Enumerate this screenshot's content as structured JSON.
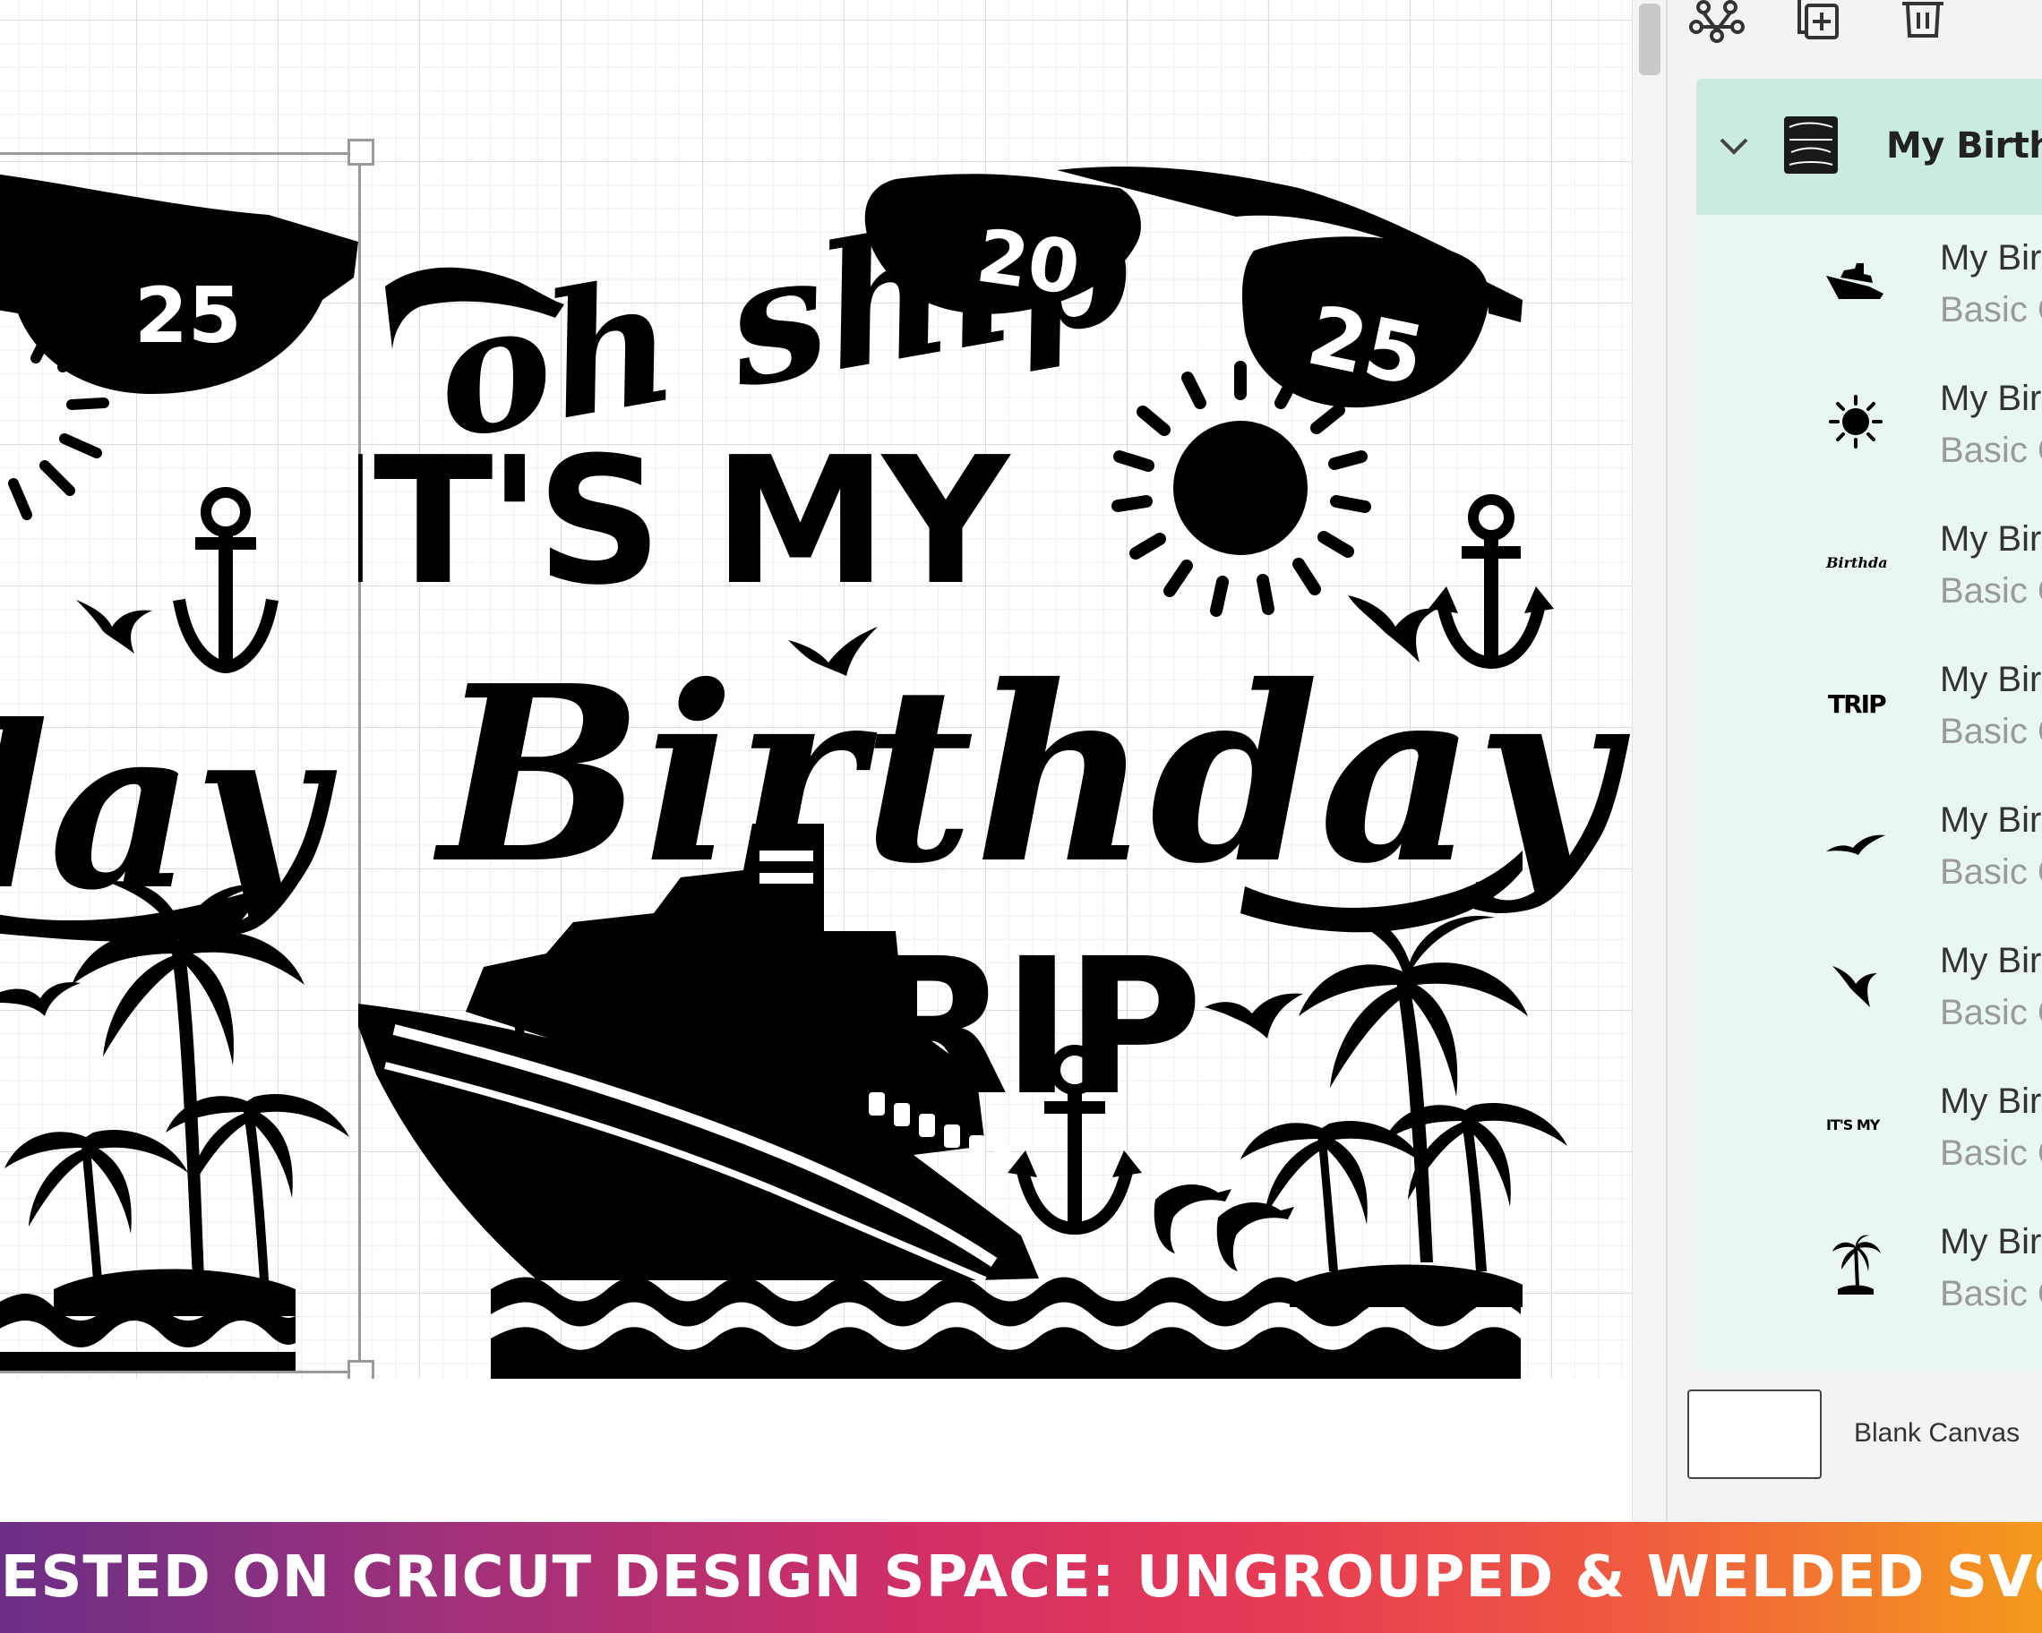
{
  "design": {
    "line1": "oh ship",
    "line2": "IT'S MY",
    "line3": "Birthday",
    "line4": "TRIP",
    "year_left": "20",
    "year_right": "25",
    "partial_script": "day",
    "partial_year": "25"
  },
  "toolbar": {
    "icons": [
      "ungroup-icon",
      "duplicate-icon",
      "delete-icon"
    ]
  },
  "layers": {
    "group_name": "My Birthday",
    "items": [
      {
        "name": "My Bir",
        "type": "Basic C",
        "thumb": "ship"
      },
      {
        "name": "My Bir",
        "type": "Basic C",
        "thumb": "sun"
      },
      {
        "name": "My Bir",
        "type": "Basic C",
        "thumb": "birthday-text"
      },
      {
        "name": "My Bir",
        "type": "Basic C",
        "thumb": "trip-text"
      },
      {
        "name": "My Bir",
        "type": "Basic C",
        "thumb": "bird"
      },
      {
        "name": "My Bir",
        "type": "Basic C",
        "thumb": "seagull"
      },
      {
        "name": "My Bir",
        "type": "Basic C",
        "thumb": "itsmy-text"
      },
      {
        "name": "My Bir",
        "type": "Basic C",
        "thumb": "palm"
      }
    ],
    "thumb_labels": {
      "birthday": "Birthday",
      "trip": "TRIP",
      "itsmy": "IT'S MY"
    }
  },
  "blank_canvas": {
    "label": "Blank Canvas"
  },
  "banner": {
    "text": "TESTED ON CRICUT DESIGN SPACE: UNGROUPED & WELDED SVG"
  },
  "colors": {
    "selected_group": "#c9ebe0",
    "layer_list_bg": "#e9f7f2",
    "ink": "#000000",
    "banner_gradient": [
      "#6b2f86",
      "#d12f65",
      "#f59a1d"
    ]
  }
}
